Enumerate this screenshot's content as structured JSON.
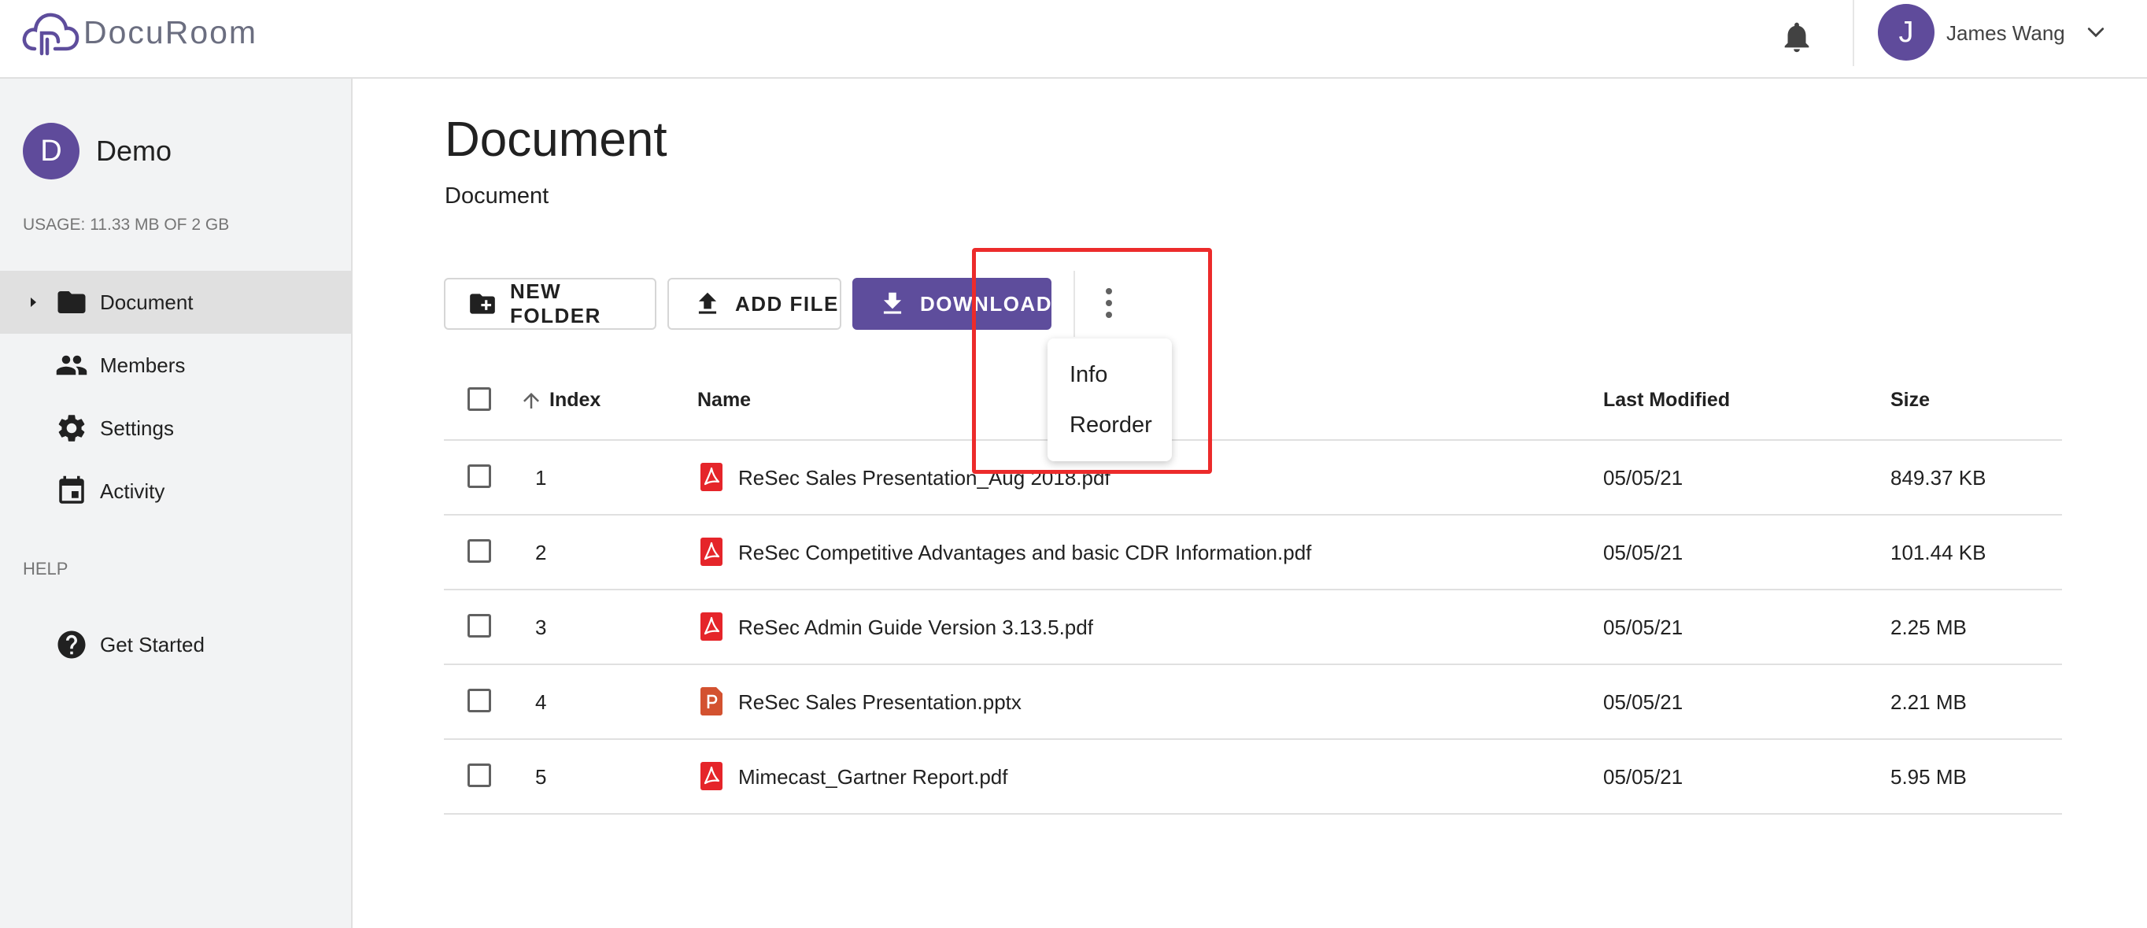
{
  "header": {
    "logo_text": "DocuRoom",
    "user": {
      "initial": "J",
      "name": "James Wang"
    }
  },
  "sidebar": {
    "org": {
      "initial": "D",
      "name": "Demo"
    },
    "usage": "USAGE: 11.33 MB OF 2 GB",
    "items": [
      {
        "label": "Document",
        "icon": "folder-icon",
        "active": true
      },
      {
        "label": "Members",
        "icon": "people-icon"
      },
      {
        "label": "Settings",
        "icon": "gear-icon"
      },
      {
        "label": "Activity",
        "icon": "calendar-icon"
      }
    ],
    "help_heading": "HELP",
    "help_items": [
      {
        "label": "Get Started",
        "icon": "help-circle-icon"
      }
    ]
  },
  "main": {
    "title": "Document",
    "breadcrumb": "Document",
    "toolbar": {
      "new_folder": "NEW FOLDER",
      "add_file": "ADD FILE",
      "download": "DOWNLOAD"
    },
    "menu": {
      "items": [
        "Info",
        "Reorder"
      ]
    },
    "table": {
      "columns": {
        "index": "Index",
        "name": "Name",
        "modified": "Last Modified",
        "size": "Size"
      },
      "rows": [
        {
          "index": "1",
          "name": "ReSec Sales Presentation_Aug 2018.pdf",
          "modified": "05/05/21",
          "size": "849.37 KB",
          "type": "pdf"
        },
        {
          "index": "2",
          "name": "ReSec Competitive Advantages and basic CDR Information.pdf",
          "modified": "05/05/21",
          "size": "101.44 KB",
          "type": "pdf"
        },
        {
          "index": "3",
          "name": "ReSec Admin Guide Version 3.13.5.pdf",
          "modified": "05/05/21",
          "size": "2.25 MB",
          "type": "pdf"
        },
        {
          "index": "4",
          "name": "ReSec Sales Presentation.pptx",
          "modified": "05/05/21",
          "size": "2.21 MB",
          "type": "pptx"
        },
        {
          "index": "5",
          "name": "Mimecast_Gartner Report.pdf",
          "modified": "05/05/21",
          "size": "5.95 MB",
          "type": "pdf"
        }
      ]
    }
  },
  "colors": {
    "primary": "#5e4d9c",
    "pdf_red": "#e5252a",
    "pptx_orange": "#d35230",
    "highlight_red": "#ec2b2b",
    "sidebar_bg": "#f2f3f4"
  }
}
